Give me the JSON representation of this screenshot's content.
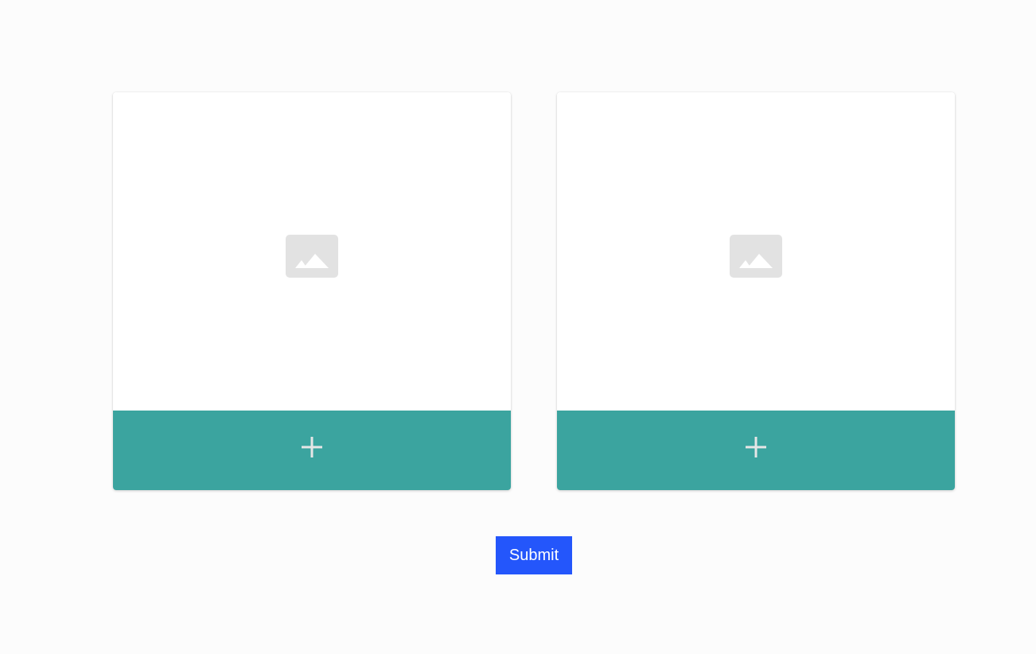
{
  "cards": [
    {
      "placeholder_icon": "image-placeholder-icon",
      "add_icon": "plus-icon"
    },
    {
      "placeholder_icon": "image-placeholder-icon",
      "add_icon": "plus-icon"
    }
  ],
  "submit": {
    "label": "Submit"
  },
  "colors": {
    "page_background": "#fcfcfc",
    "card_background": "#ffffff",
    "add_bar": "#3ba49f",
    "plus_icon": "#e6e6e6",
    "placeholder_icon": "#e2e2e2",
    "submit_button": "#2456fb",
    "submit_text": "#ffffff"
  }
}
